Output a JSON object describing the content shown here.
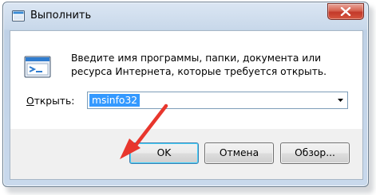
{
  "window": {
    "title": "Выполнить",
    "close_icon": "close-icon"
  },
  "content": {
    "description": "Введите имя программы, папки, документа или ресурса Интернета, которые требуется открыть.",
    "open_label_accel": "О",
    "open_label_rest": "ткрыть:",
    "command_value": "msinfo32"
  },
  "buttons": {
    "ok": "OK",
    "cancel": "Отмена",
    "browse": "Обзор..."
  },
  "colors": {
    "selection": "#3399ff",
    "annotation_arrow": "#e8362d",
    "close_button": "#c3392a"
  }
}
